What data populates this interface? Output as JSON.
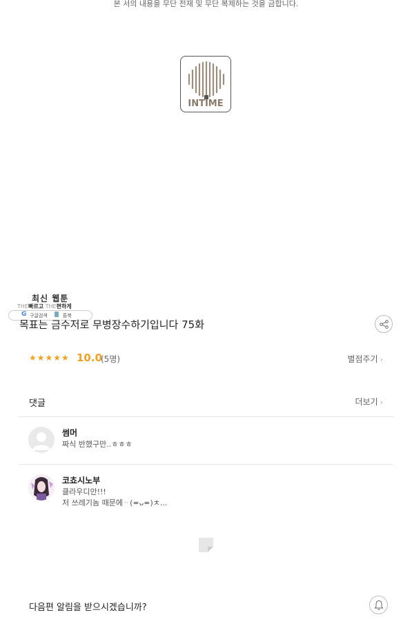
{
  "notice": "본 서의 내용을 무단 전재 및 무단 복제하는 것을 금합니다.",
  "logo_text": "INTIME",
  "promo": {
    "headline": "최신 웹툰",
    "sub_the1": "THE",
    "sub_fast": "빠르고",
    "sub_the2": "THE",
    "sub_easy": "편하게",
    "google_label": "구글검색",
    "toonbook_label": "툰북"
  },
  "episode_title": "목표는 금수저로 무병장수하기입니다 75화",
  "rating": {
    "stars": "★★★★★",
    "score": "10.0",
    "count": "(5명)",
    "rate_link": "별점주기"
  },
  "comments": {
    "header": "댓글",
    "more_link": "더보기",
    "items": [
      {
        "author": "썸머",
        "text_line1": "짜식 반했구만..ㅎㅎㅎ",
        "text_line2": ""
      },
      {
        "author": "코쵸시노부",
        "text_line1": "클라우디안!!!",
        "text_line2": "저 쓰레기놈 때문에ᆢ(≖ᴗ≖)ㅊ..."
      }
    ]
  },
  "alert_question": "다음편 알림을 받으시겠습니까?",
  "icons": {
    "share": "share-icon",
    "bell": "bell-icon",
    "chevron": "chevron-right-icon"
  },
  "colors": {
    "star": "#f4a020",
    "text": "#222222",
    "muted": "#666666"
  }
}
